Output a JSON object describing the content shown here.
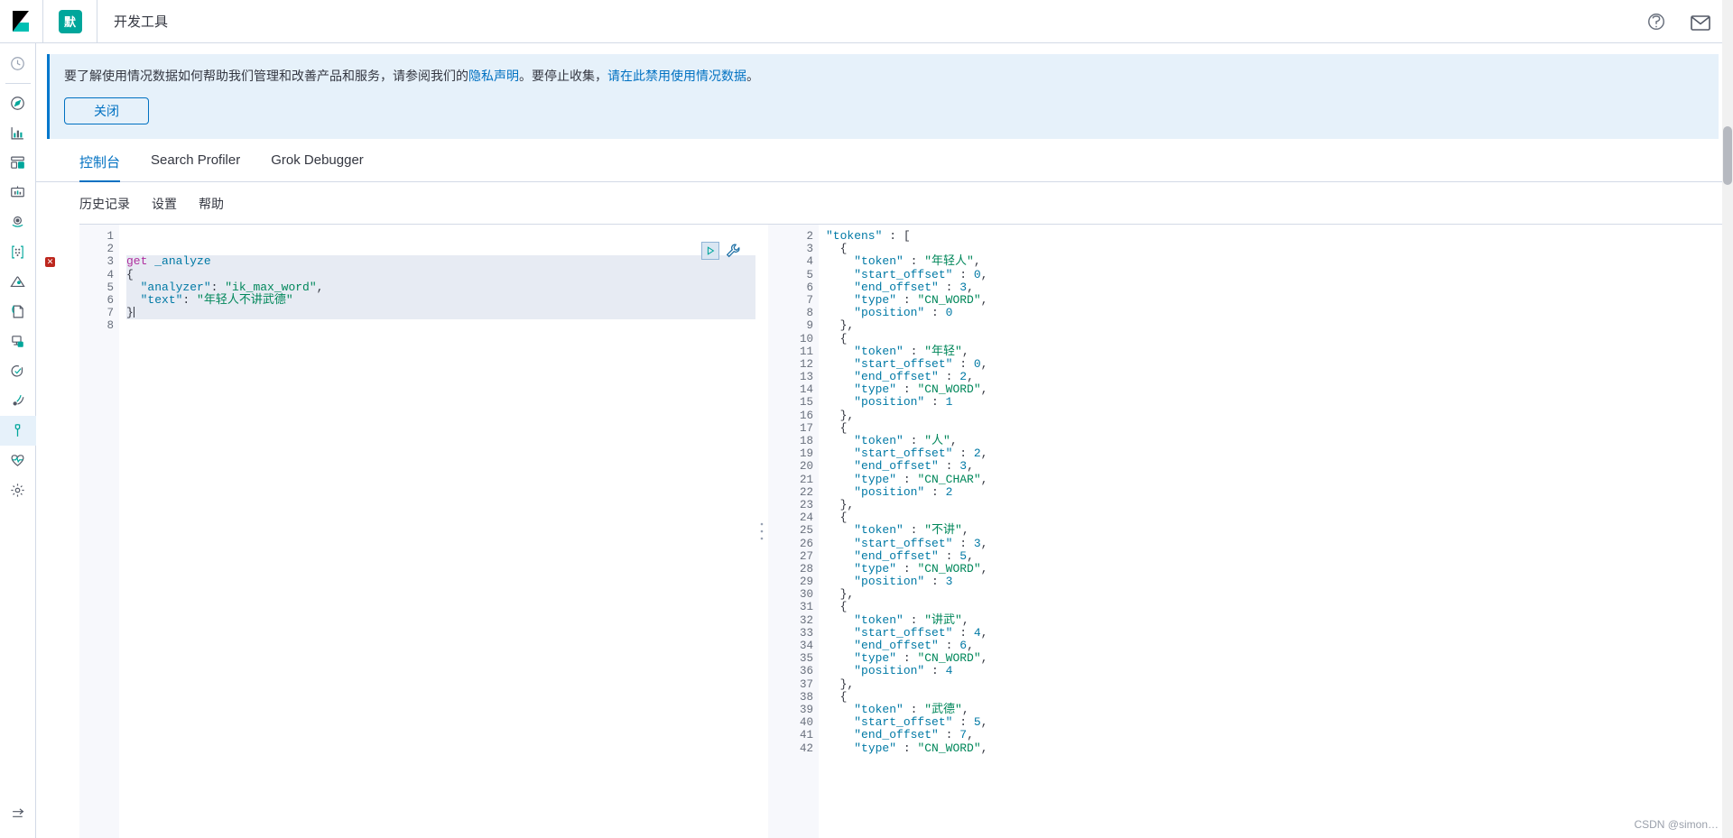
{
  "header": {
    "space_badge": "默",
    "breadcrumb": "开发工具",
    "help_icon": "help-circle-icon",
    "mail_icon": "mail-icon"
  },
  "sidebar": {
    "items": [
      {
        "name": "recently-viewed",
        "icon": "clock-icon"
      },
      {
        "name": "discover",
        "icon": "compass-icon"
      },
      {
        "name": "visualize",
        "icon": "bar-chart-icon"
      },
      {
        "name": "dashboard",
        "icon": "dashboard-icon"
      },
      {
        "name": "canvas",
        "icon": "presentation-icon"
      },
      {
        "name": "maps",
        "icon": "map-pin-icon"
      },
      {
        "name": "machine-learning",
        "icon": "ml-nodes-icon"
      },
      {
        "name": "infrastructure",
        "icon": "infra-icon"
      },
      {
        "name": "logs",
        "icon": "logs-icon"
      },
      {
        "name": "apm",
        "icon": "apm-icon"
      },
      {
        "name": "uptime",
        "icon": "uptime-check-icon"
      },
      {
        "name": "siem",
        "icon": "siem-signal-icon"
      },
      {
        "name": "dev-tools",
        "icon": "wrench-icon"
      },
      {
        "name": "monitoring",
        "icon": "heart-monitor-icon"
      },
      {
        "name": "management",
        "icon": "gear-icon"
      }
    ],
    "collapse_icon": "collapse-arrow-icon"
  },
  "callout": {
    "text_1": "要了解使用情况数据如何帮助我们管理和改善产品和服务，请参阅我们的",
    "link_1": "隐私声明",
    "text_2": "。要停止收集，",
    "link_2": "请在此禁用使用情况数据",
    "text_3": "。",
    "close_label": "关闭"
  },
  "tabs": [
    {
      "label": "控制台",
      "active": true
    },
    {
      "label": "Search Profiler",
      "active": false
    },
    {
      "label": "Grok Debugger",
      "active": false
    }
  ],
  "submenu": [
    {
      "label": "历史记录"
    },
    {
      "label": "设置"
    },
    {
      "label": "帮助"
    }
  ],
  "console": {
    "run_icon": "play-triangle-icon",
    "wrench_icon": "wrench-icon",
    "drag_handle_icon": "vertical-dots-handle-icon",
    "request": {
      "lines": [
        {
          "n": 1,
          "fold": "",
          "error": false,
          "tokens": []
        },
        {
          "n": 2,
          "fold": "",
          "error": false,
          "tokens": []
        },
        {
          "n": 3,
          "fold": "",
          "error": true,
          "highlight": true,
          "tokens": [
            {
              "t": "get",
              "c": "k-method"
            },
            {
              "t": " ",
              "c": "k-plain"
            },
            {
              "t": "_analyze",
              "c": "k-url"
            }
          ]
        },
        {
          "n": 4,
          "fold": "down",
          "error": false,
          "highlight": true,
          "tokens": [
            {
              "t": "{",
              "c": "k-punct"
            }
          ]
        },
        {
          "n": 5,
          "fold": "",
          "error": false,
          "highlight": true,
          "tokens": [
            {
              "t": "  ",
              "c": "k-plain"
            },
            {
              "t": "\"analyzer\"",
              "c": "k-key"
            },
            {
              "t": ": ",
              "c": "k-punct"
            },
            {
              "t": "\"ik_max_word\"",
              "c": "k-str"
            },
            {
              "t": ",",
              "c": "k-punct"
            }
          ]
        },
        {
          "n": 6,
          "fold": "",
          "error": false,
          "highlight": true,
          "tokens": [
            {
              "t": "  ",
              "c": "k-plain"
            },
            {
              "t": "\"text\"",
              "c": "k-key"
            },
            {
              "t": ": ",
              "c": "k-punct"
            },
            {
              "t": "\"年轻人不讲武德\"",
              "c": "k-str"
            }
          ]
        },
        {
          "n": 7,
          "fold": "up",
          "error": false,
          "cursor": true,
          "tokens": [
            {
              "t": "}",
              "c": "k-punct"
            }
          ]
        },
        {
          "n": 8,
          "fold": "",
          "error": false,
          "tokens": []
        }
      ]
    },
    "response": {
      "lines": [
        {
          "n": 2,
          "fold": "down",
          "indent": 0,
          "tokens": [
            {
              "t": "\"tokens\"",
              "c": "k-key"
            },
            {
              "t": " : ",
              "c": "k-punct"
            },
            {
              "t": "[",
              "c": "k-punct"
            }
          ]
        },
        {
          "n": 3,
          "fold": "down",
          "indent": 1,
          "tokens": [
            {
              "t": "{",
              "c": "k-punct"
            }
          ]
        },
        {
          "n": 4,
          "fold": "",
          "indent": 2,
          "tokens": [
            {
              "t": "\"token\"",
              "c": "k-key"
            },
            {
              "t": " : ",
              "c": "k-punct"
            },
            {
              "t": "\"年轻人\"",
              "c": "k-str"
            },
            {
              "t": ",",
              "c": "k-punct"
            }
          ]
        },
        {
          "n": 5,
          "fold": "",
          "indent": 2,
          "tokens": [
            {
              "t": "\"start_offset\"",
              "c": "k-key"
            },
            {
              "t": " : ",
              "c": "k-punct"
            },
            {
              "t": "0",
              "c": "k-num"
            },
            {
              "t": ",",
              "c": "k-punct"
            }
          ]
        },
        {
          "n": 6,
          "fold": "",
          "indent": 2,
          "tokens": [
            {
              "t": "\"end_offset\"",
              "c": "k-key"
            },
            {
              "t": " : ",
              "c": "k-punct"
            },
            {
              "t": "3",
              "c": "k-num"
            },
            {
              "t": ",",
              "c": "k-punct"
            }
          ]
        },
        {
          "n": 7,
          "fold": "",
          "indent": 2,
          "tokens": [
            {
              "t": "\"type\"",
              "c": "k-key"
            },
            {
              "t": " : ",
              "c": "k-punct"
            },
            {
              "t": "\"CN_WORD\"",
              "c": "k-str"
            },
            {
              "t": ",",
              "c": "k-punct"
            }
          ]
        },
        {
          "n": 8,
          "fold": "",
          "indent": 2,
          "tokens": [
            {
              "t": "\"position\"",
              "c": "k-key"
            },
            {
              "t": " : ",
              "c": "k-punct"
            },
            {
              "t": "0",
              "c": "k-num"
            }
          ]
        },
        {
          "n": 9,
          "fold": "up",
          "indent": 1,
          "tokens": [
            {
              "t": "},",
              "c": "k-punct"
            }
          ]
        },
        {
          "n": 10,
          "fold": "down",
          "indent": 1,
          "tokens": [
            {
              "t": "{",
              "c": "k-punct"
            }
          ]
        },
        {
          "n": 11,
          "fold": "",
          "indent": 2,
          "tokens": [
            {
              "t": "\"token\"",
              "c": "k-key"
            },
            {
              "t": " : ",
              "c": "k-punct"
            },
            {
              "t": "\"年轻\"",
              "c": "k-str"
            },
            {
              "t": ",",
              "c": "k-punct"
            }
          ]
        },
        {
          "n": 12,
          "fold": "",
          "indent": 2,
          "tokens": [
            {
              "t": "\"start_offset\"",
              "c": "k-key"
            },
            {
              "t": " : ",
              "c": "k-punct"
            },
            {
              "t": "0",
              "c": "k-num"
            },
            {
              "t": ",",
              "c": "k-punct"
            }
          ]
        },
        {
          "n": 13,
          "fold": "",
          "indent": 2,
          "tokens": [
            {
              "t": "\"end_offset\"",
              "c": "k-key"
            },
            {
              "t": " : ",
              "c": "k-punct"
            },
            {
              "t": "2",
              "c": "k-num"
            },
            {
              "t": ",",
              "c": "k-punct"
            }
          ]
        },
        {
          "n": 14,
          "fold": "",
          "indent": 2,
          "tokens": [
            {
              "t": "\"type\"",
              "c": "k-key"
            },
            {
              "t": " : ",
              "c": "k-punct"
            },
            {
              "t": "\"CN_WORD\"",
              "c": "k-str"
            },
            {
              "t": ",",
              "c": "k-punct"
            }
          ]
        },
        {
          "n": 15,
          "fold": "",
          "indent": 2,
          "tokens": [
            {
              "t": "\"position\"",
              "c": "k-key"
            },
            {
              "t": " : ",
              "c": "k-punct"
            },
            {
              "t": "1",
              "c": "k-num"
            }
          ]
        },
        {
          "n": 16,
          "fold": "up",
          "indent": 1,
          "tokens": [
            {
              "t": "},",
              "c": "k-punct"
            }
          ]
        },
        {
          "n": 17,
          "fold": "down",
          "indent": 1,
          "tokens": [
            {
              "t": "{",
              "c": "k-punct"
            }
          ]
        },
        {
          "n": 18,
          "fold": "",
          "indent": 2,
          "tokens": [
            {
              "t": "\"token\"",
              "c": "k-key"
            },
            {
              "t": " : ",
              "c": "k-punct"
            },
            {
              "t": "\"人\"",
              "c": "k-str"
            },
            {
              "t": ",",
              "c": "k-punct"
            }
          ]
        },
        {
          "n": 19,
          "fold": "",
          "indent": 2,
          "tokens": [
            {
              "t": "\"start_offset\"",
              "c": "k-key"
            },
            {
              "t": " : ",
              "c": "k-punct"
            },
            {
              "t": "2",
              "c": "k-num"
            },
            {
              "t": ",",
              "c": "k-punct"
            }
          ]
        },
        {
          "n": 20,
          "fold": "",
          "indent": 2,
          "tokens": [
            {
              "t": "\"end_offset\"",
              "c": "k-key"
            },
            {
              "t": " : ",
              "c": "k-punct"
            },
            {
              "t": "3",
              "c": "k-num"
            },
            {
              "t": ",",
              "c": "k-punct"
            }
          ]
        },
        {
          "n": 21,
          "fold": "",
          "indent": 2,
          "tokens": [
            {
              "t": "\"type\"",
              "c": "k-key"
            },
            {
              "t": " : ",
              "c": "k-punct"
            },
            {
              "t": "\"CN_CHAR\"",
              "c": "k-str"
            },
            {
              "t": ",",
              "c": "k-punct"
            }
          ]
        },
        {
          "n": 22,
          "fold": "",
          "indent": 2,
          "tokens": [
            {
              "t": "\"position\"",
              "c": "k-key"
            },
            {
              "t": " : ",
              "c": "k-punct"
            },
            {
              "t": "2",
              "c": "k-num"
            }
          ]
        },
        {
          "n": 23,
          "fold": "up",
          "indent": 1,
          "tokens": [
            {
              "t": "},",
              "c": "k-punct"
            }
          ]
        },
        {
          "n": 24,
          "fold": "down",
          "indent": 1,
          "tokens": [
            {
              "t": "{",
              "c": "k-punct"
            }
          ]
        },
        {
          "n": 25,
          "fold": "",
          "indent": 2,
          "tokens": [
            {
              "t": "\"token\"",
              "c": "k-key"
            },
            {
              "t": " : ",
              "c": "k-punct"
            },
            {
              "t": "\"不讲\"",
              "c": "k-str"
            },
            {
              "t": ",",
              "c": "k-punct"
            }
          ]
        },
        {
          "n": 26,
          "fold": "",
          "indent": 2,
          "tokens": [
            {
              "t": "\"start_offset\"",
              "c": "k-key"
            },
            {
              "t": " : ",
              "c": "k-punct"
            },
            {
              "t": "3",
              "c": "k-num"
            },
            {
              "t": ",",
              "c": "k-punct"
            }
          ]
        },
        {
          "n": 27,
          "fold": "",
          "indent": 2,
          "tokens": [
            {
              "t": "\"end_offset\"",
              "c": "k-key"
            },
            {
              "t": " : ",
              "c": "k-punct"
            },
            {
              "t": "5",
              "c": "k-num"
            },
            {
              "t": ",",
              "c": "k-punct"
            }
          ]
        },
        {
          "n": 28,
          "fold": "",
          "indent": 2,
          "tokens": [
            {
              "t": "\"type\"",
              "c": "k-key"
            },
            {
              "t": " : ",
              "c": "k-punct"
            },
            {
              "t": "\"CN_WORD\"",
              "c": "k-str"
            },
            {
              "t": ",",
              "c": "k-punct"
            }
          ]
        },
        {
          "n": 29,
          "fold": "",
          "indent": 2,
          "tokens": [
            {
              "t": "\"position\"",
              "c": "k-key"
            },
            {
              "t": " : ",
              "c": "k-punct"
            },
            {
              "t": "3",
              "c": "k-num"
            }
          ]
        },
        {
          "n": 30,
          "fold": "up",
          "indent": 1,
          "tokens": [
            {
              "t": "},",
              "c": "k-punct"
            }
          ]
        },
        {
          "n": 31,
          "fold": "down",
          "indent": 1,
          "tokens": [
            {
              "t": "{",
              "c": "k-punct"
            }
          ]
        },
        {
          "n": 32,
          "fold": "",
          "indent": 2,
          "tokens": [
            {
              "t": "\"token\"",
              "c": "k-key"
            },
            {
              "t": " : ",
              "c": "k-punct"
            },
            {
              "t": "\"讲武\"",
              "c": "k-str"
            },
            {
              "t": ",",
              "c": "k-punct"
            }
          ]
        },
        {
          "n": 33,
          "fold": "",
          "indent": 2,
          "tokens": [
            {
              "t": "\"start_offset\"",
              "c": "k-key"
            },
            {
              "t": " : ",
              "c": "k-punct"
            },
            {
              "t": "4",
              "c": "k-num"
            },
            {
              "t": ",",
              "c": "k-punct"
            }
          ]
        },
        {
          "n": 34,
          "fold": "",
          "indent": 2,
          "tokens": [
            {
              "t": "\"end_offset\"",
              "c": "k-key"
            },
            {
              "t": " : ",
              "c": "k-punct"
            },
            {
              "t": "6",
              "c": "k-num"
            },
            {
              "t": ",",
              "c": "k-punct"
            }
          ]
        },
        {
          "n": 35,
          "fold": "",
          "indent": 2,
          "tokens": [
            {
              "t": "\"type\"",
              "c": "k-key"
            },
            {
              "t": " : ",
              "c": "k-punct"
            },
            {
              "t": "\"CN_WORD\"",
              "c": "k-str"
            },
            {
              "t": ",",
              "c": "k-punct"
            }
          ]
        },
        {
          "n": 36,
          "fold": "",
          "indent": 2,
          "tokens": [
            {
              "t": "\"position\"",
              "c": "k-key"
            },
            {
              "t": " : ",
              "c": "k-punct"
            },
            {
              "t": "4",
              "c": "k-num"
            }
          ]
        },
        {
          "n": 37,
          "fold": "up",
          "indent": 1,
          "tokens": [
            {
              "t": "},",
              "c": "k-punct"
            }
          ]
        },
        {
          "n": 38,
          "fold": "down",
          "indent": 1,
          "tokens": [
            {
              "t": "{",
              "c": "k-punct"
            }
          ]
        },
        {
          "n": 39,
          "fold": "",
          "indent": 2,
          "tokens": [
            {
              "t": "\"token\"",
              "c": "k-key"
            },
            {
              "t": " : ",
              "c": "k-punct"
            },
            {
              "t": "\"武德\"",
              "c": "k-str"
            },
            {
              "t": ",",
              "c": "k-punct"
            }
          ]
        },
        {
          "n": 40,
          "fold": "",
          "indent": 2,
          "tokens": [
            {
              "t": "\"start_offset\"",
              "c": "k-key"
            },
            {
              "t": " : ",
              "c": "k-punct"
            },
            {
              "t": "5",
              "c": "k-num"
            },
            {
              "t": ",",
              "c": "k-punct"
            }
          ]
        },
        {
          "n": 41,
          "fold": "",
          "indent": 2,
          "tokens": [
            {
              "t": "\"end_offset\"",
              "c": "k-key"
            },
            {
              "t": " : ",
              "c": "k-punct"
            },
            {
              "t": "7",
              "c": "k-num"
            },
            {
              "t": ",",
              "c": "k-punct"
            }
          ]
        },
        {
          "n": 42,
          "fold": "",
          "indent": 2,
          "tokens": [
            {
              "t": "\"type\"",
              "c": "k-key"
            },
            {
              "t": " : ",
              "c": "k-punct"
            },
            {
              "t": "\"CN_WORD\"",
              "c": "k-str"
            },
            {
              "t": ",",
              "c": "k-punct"
            }
          ]
        }
      ]
    }
  },
  "watermark": "CSDN @simon…"
}
